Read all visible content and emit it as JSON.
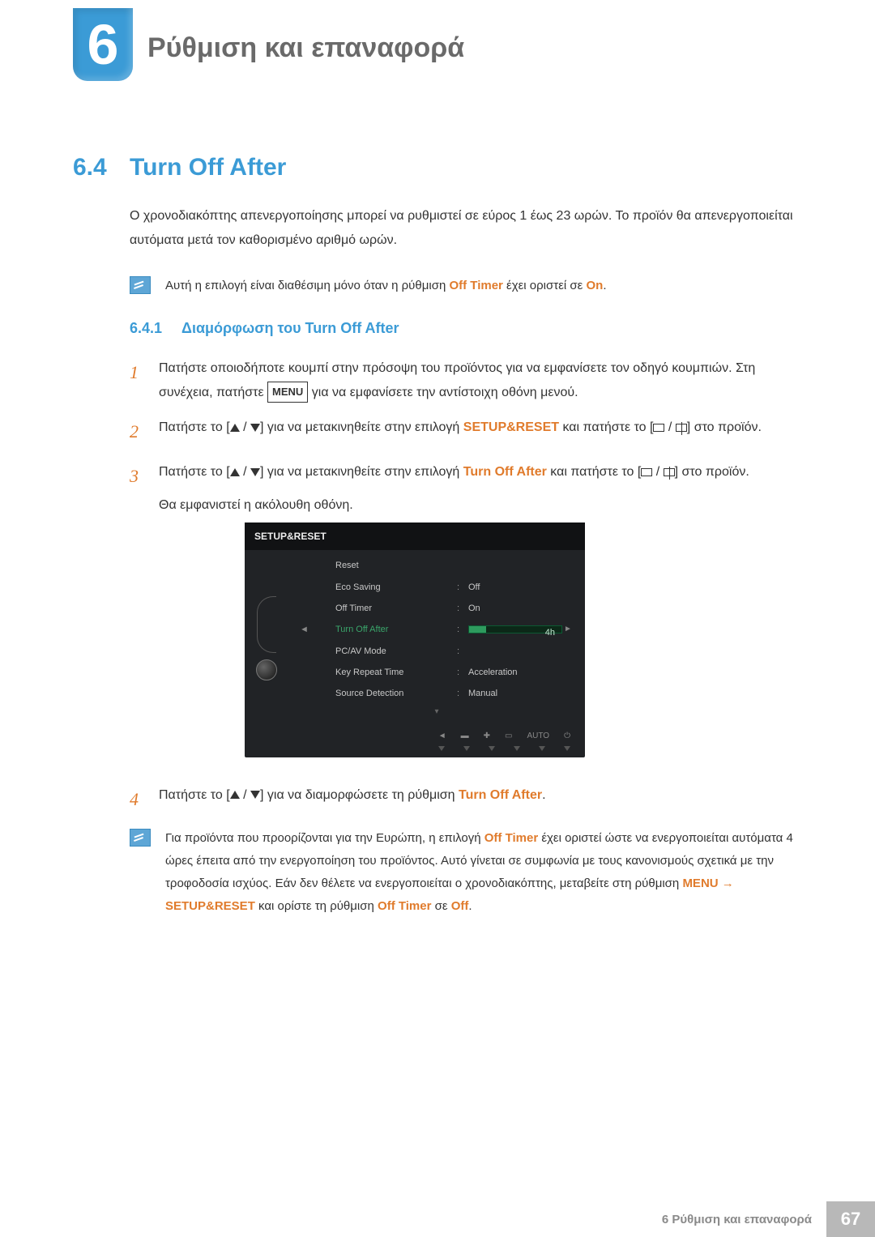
{
  "chapter": {
    "number": "6",
    "title": "Ρύθμιση και επαναφορά"
  },
  "section": {
    "number": "6.4",
    "title": "Turn Off After"
  },
  "intro": "Ο χρονοδιακόπτης απενεργοποίησης μπορεί να ρυθμιστεί σε εύρος 1 έως 23 ωρών. Το προϊόν θα απενεργοποιείται αυτόματα μετά τον καθορισμένο αριθμό ωρών.",
  "note1_prefix": "Αυτή η επιλογή είναι διαθέσιμη μόνο όταν η ρύθμιση ",
  "note1_bold1": "Off Timer",
  "note1_mid": " έχει οριστεί σε ",
  "note1_bold2": "On",
  "note1_suffix": ".",
  "subsection": {
    "number": "6.4.1",
    "title": "Διαμόρφωση του Turn Off After"
  },
  "steps": {
    "s1": {
      "num": "1",
      "t1": "Πατήστε οποιοδήποτε κουμπί στην πρόσοψη του προϊόντος για να εμφανίσετε τον οδηγό κουμπιών. Στη συνέχεια, πατήστε ",
      "menu": "MENU",
      "t2": " για να εμφανίσετε την αντίστοιχη οθόνη μενού."
    },
    "s2": {
      "num": "2",
      "t1": "Πατήστε το [",
      "t2": "] για να μετακινηθείτε στην επιλογή ",
      "kw": "SETUP&RESET",
      "t3": " και πατήστε το [",
      "t4": "] στο προϊόν."
    },
    "s3": {
      "num": "3",
      "t1": "Πατήστε το [",
      "t2": "] για να μετακινηθείτε στην επιλογή ",
      "kw": "Turn Off After",
      "t3": " και πατήστε το [",
      "t4": "] στο προϊόν.",
      "after": "Θα εμφανιστεί η ακόλουθη οθόνη."
    },
    "s4": {
      "num": "4",
      "t1": "Πατήστε το [",
      "t2": "] για να διαμορφώσετε τη ρύθμιση ",
      "kw": "Turn Off After",
      "t3": "."
    }
  },
  "note2": {
    "t1": "Για προϊόντα που προορίζονται για την Ευρώπη, η επιλογή ",
    "kw1": "Off Timer",
    "t2": " έχει οριστεί ώστε να ενεργοποιείται αυτόματα 4 ώρες έπειτα από την ενεργοποίηση του προϊόντος. Αυτό γίνεται σε συμφωνία με τους κανονισμούς σχετικά με την τροφοδοσία ισχύος. Εάν δεν θέλετε να ενεργοποιείται ο χρονοδιακόπτης, μεταβείτε στη ρύθμιση ",
    "kw2": "MENU",
    "arrow": " → ",
    "kw3": "SETUP&RESET",
    "t3": " και ορίστε τη ρύθμιση ",
    "kw4": "Off Timer",
    "t4": " σε ",
    "kw5": "Off",
    "t5": "."
  },
  "osd": {
    "header": "SETUP&RESET",
    "rows": [
      {
        "label": "Reset",
        "value": ""
      },
      {
        "label": "Eco Saving",
        "value": "Off"
      },
      {
        "label": "Off Timer",
        "value": "On"
      },
      {
        "label": "Turn Off After",
        "value": "4h",
        "selected": true,
        "slider": true
      },
      {
        "label": "PC/AV Mode",
        "value": ""
      },
      {
        "label": "Key Repeat Time",
        "value": "Acceleration"
      },
      {
        "label": "Source Detection",
        "value": "Manual"
      }
    ],
    "footer_auto": "AUTO"
  },
  "footer": {
    "text": "6 Ρύθμιση και επαναφορά",
    "page": "67"
  }
}
